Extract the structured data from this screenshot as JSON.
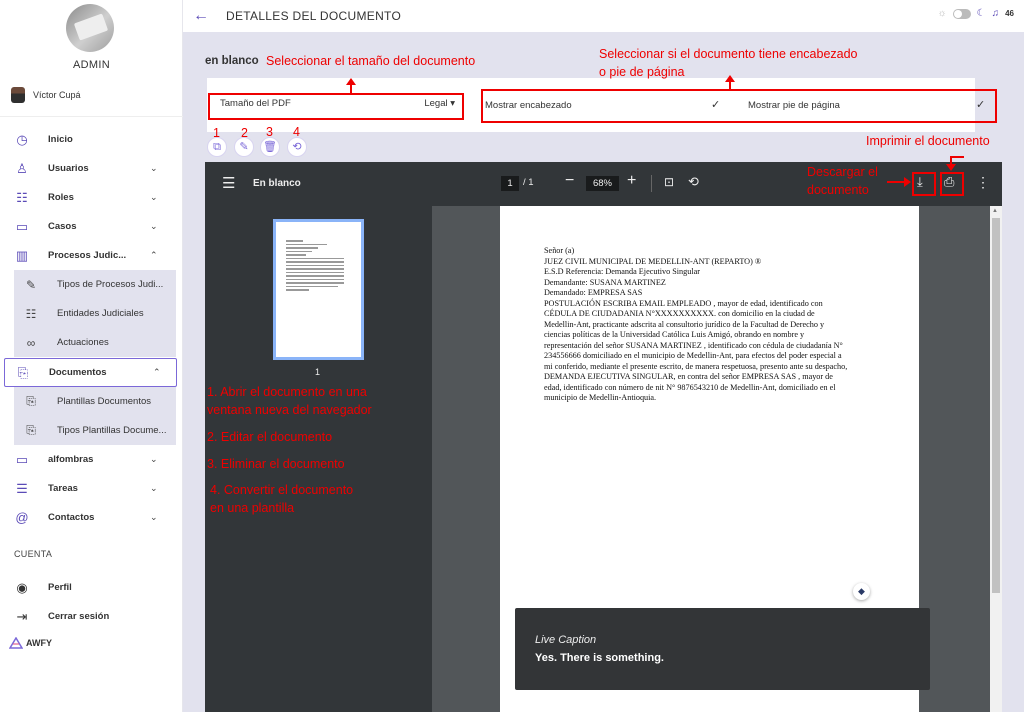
{
  "sidebar": {
    "admin_label": "ADMIN",
    "user_name": "Víctor Cupá",
    "items": [
      {
        "label": "Inicio",
        "icon": "clock-icon",
        "glyph": "◷"
      },
      {
        "label": "Usuarios",
        "icon": "user-icon",
        "glyph": "♙",
        "chevron": "⌄"
      },
      {
        "label": "Roles",
        "icon": "roles-icon",
        "glyph": "☷",
        "chevron": "⌄"
      },
      {
        "label": "Casos",
        "icon": "briefcase-icon",
        "glyph": "▭",
        "chevron": "⌄"
      },
      {
        "label": "Procesos Judic...",
        "icon": "building-icon",
        "glyph": "▥",
        "chevron": "⌃"
      }
    ],
    "sub_procesos": [
      {
        "label": "Tipos de Procesos Judi...",
        "icon": "wrench-icon",
        "glyph": "✎"
      },
      {
        "label": "Entidades Judiciales",
        "icon": "roles-icon",
        "glyph": "☷"
      },
      {
        "label": "Actuaciones",
        "icon": "glasses-icon",
        "glyph": "∞"
      }
    ],
    "documentos": {
      "label": "Documentos",
      "icon": "documents-icon",
      "glyph": "⎘",
      "chevron": "⌃"
    },
    "sub_documentos": [
      {
        "label": "Plantillas Documentos",
        "icon": "documents-icon",
        "glyph": "⎘"
      },
      {
        "label": "Tipos Plantillas Docume...",
        "icon": "documents-icon",
        "glyph": "⎘"
      }
    ],
    "items2": [
      {
        "label": "alfombras",
        "icon": "folder-icon",
        "glyph": "▭",
        "chevron": "⌄"
      },
      {
        "label": "Tareas",
        "icon": "list-icon",
        "glyph": "☰",
        "chevron": "⌄"
      },
      {
        "label": "Contactos",
        "icon": "at-icon",
        "glyph": "@",
        "chevron": "⌄"
      }
    ],
    "cuenta_label": "CUENTA",
    "perfil": {
      "label": "Perfil",
      "icon": "profile-icon",
      "glyph": "◉"
    },
    "logout": {
      "label": "Cerrar sesión",
      "icon": "logout-icon",
      "glyph": "⇥"
    },
    "brand": "AWFY"
  },
  "topbar": {
    "back_glyph": "←",
    "title": "DETALLES DEL DOCUMENTO",
    "notif_count": "46"
  },
  "main": {
    "doc_heading": "en blanco",
    "size_label": "Tamaño del PDF",
    "size_value": "Legal ▾",
    "header_label": "Mostrar encabezado",
    "footer_label": "Mostrar pie de página",
    "check": "✓",
    "actions": [
      {
        "name": "open-new-window-icon",
        "glyph": "⧉"
      },
      {
        "name": "edit-icon",
        "glyph": "✎"
      },
      {
        "name": "trash-icon",
        "glyph": "🗑"
      },
      {
        "name": "convert-icon",
        "glyph": "⟲"
      }
    ]
  },
  "viewer": {
    "title": "En blanco",
    "page_current": "1",
    "page_total": "/ 1",
    "zoom": "68%",
    "thumb_number": "1",
    "document_lines": [
      "Señor (a)",
      "JUEZ CIVIL MUNICIPAL DE MEDELLIN-ANT (REPARTO) ®",
      "E.S.D Referencia: Demanda Ejecutivo Singular",
      "Demandante: SUSANA MARTINEZ",
      "Demandado: EMPRESA SAS",
      "POSTULACIÓN ESCRIBA EMAIL EMPLEADO , mayor de edad, identificado con",
      "CÉDULA DE CIUDADANIA N°XXXXXXXXXX. con domicilio en la ciudad de",
      "Medellin-Ant, practicante adscrita al consultorio jurídico de la Facultad de Derecho y",
      "ciencias políticas de la Universidad Católica Luis Amigó, obrando en nombre y",
      "representación del señor SUSANA MARTINEZ , identificado con cédula de ciudadanía N°",
      "234556666 domiciliado en el municipio de Medellin-Ant, para efectos del poder especial a",
      "mi conferido, mediante el presente escrito, de manera respetuosa, presento ante su despacho,",
      "DEMANDA EJECUTIVA SINGULAR, en contra del señor EMPRESA SAS , mayor de",
      "edad, identificado con número de nit N° 9876543210 de Medellin-Ant, domiciliado en el",
      "municipio de Medellin-Antioquia."
    ],
    "caption_title": "Live Caption",
    "caption_text": "Yes. There is something."
  },
  "annotations": {
    "size": "Seleccionar el tamaño del documento",
    "header_footer": [
      "Seleccionar si el documento tiene encabezado",
      "o pie de página"
    ],
    "print": "Imprimir el documento",
    "download": [
      "Descargar el",
      "documento"
    ],
    "num1": "1",
    "num2": "2",
    "num3": "3",
    "num4": "4",
    "open": [
      "1. Abrir el documento en una",
      "ventana nueva del navegador"
    ],
    "edit": "2. Editar el documento",
    "delete": "3. Eliminar el documento",
    "convert": [
      "4. Convertir el documento",
      "en una plantilla"
    ]
  }
}
